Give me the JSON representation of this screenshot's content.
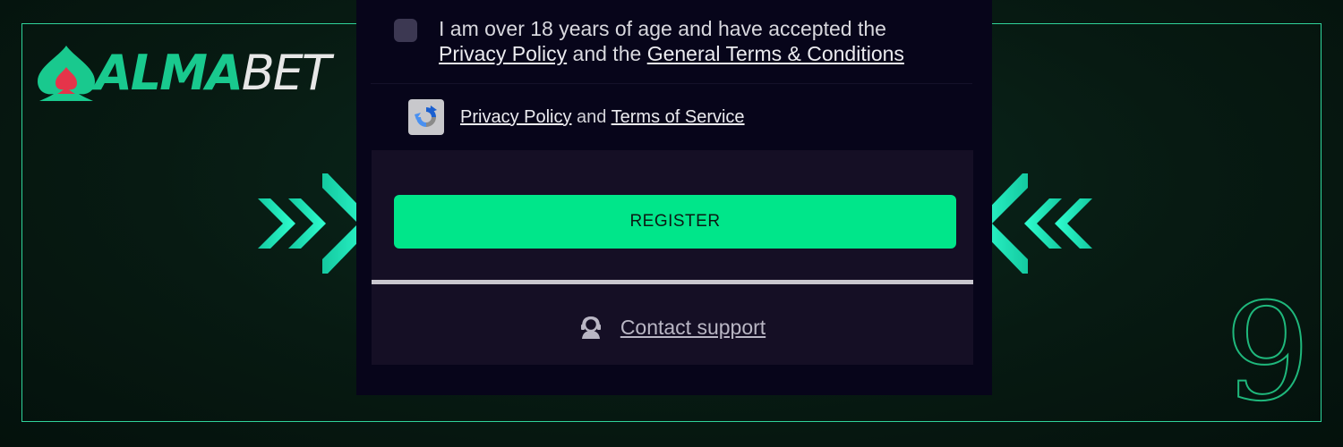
{
  "brand": {
    "name_part1": "ALMA",
    "name_part2": "BET",
    "logo_icon": "spade-icon",
    "colors": {
      "green": "#19c98e",
      "red": "#e5344a",
      "light": "#e7e7e7"
    }
  },
  "consent": {
    "line1": "I am over 18 years of age and have accepted the",
    "privacy_link": "Privacy Policy",
    "and_the": "and the",
    "terms_link": "General Terms & Conditions",
    "checked": false
  },
  "recaptcha": {
    "icon": "recaptcha-icon",
    "privacy_link": "Privacy Policy",
    "and": "and",
    "terms_link": "Terms of Service"
  },
  "register": {
    "label": "REGISTER",
    "color": "#00e68a"
  },
  "support": {
    "icon": "support-agent-icon",
    "label": "Contact support"
  },
  "decor": {
    "step_number": "9",
    "accent": "#2fd39a",
    "arrow_color": "#1ff0c0"
  }
}
